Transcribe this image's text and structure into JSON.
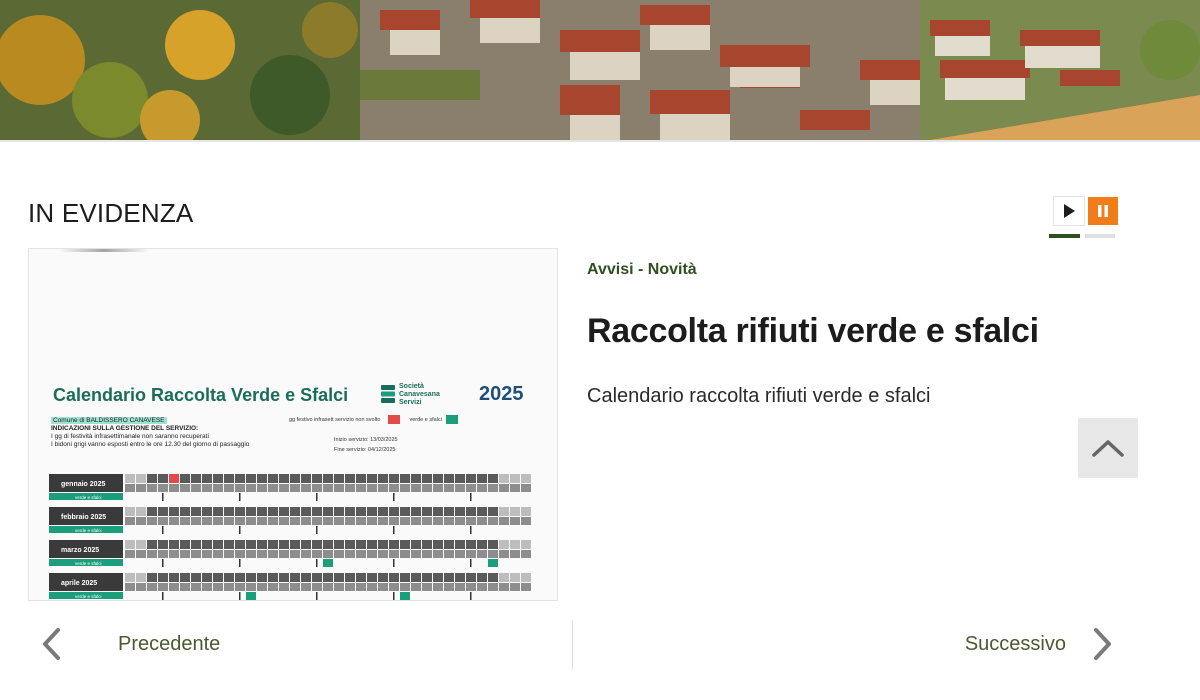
{
  "hero": {
    "colors": {
      "sky": "#5f7a3c",
      "roof": "#a7432d",
      "wall": "#d9d0c1",
      "foliage": "#c88f22",
      "grass": "#d9a45a"
    }
  },
  "section": {
    "title": "IN EVIDENZA"
  },
  "carousel": {
    "play_icon": "play-icon",
    "pause_icon": "pause-icon",
    "active_color": "#2f4f1f",
    "pause_color": "#f07d1a"
  },
  "feature_image": {
    "title": "Calendario Raccolta Verde e Sfalci",
    "year": "2025",
    "brand": [
      "Società",
      "Canavesana",
      "Servizi"
    ],
    "info": {
      "comune": "Comune di BALDISSERO CANAVESE",
      "heading": "INDICAZIONI SULLA GESTIONE DEL SERVIZIO:",
      "line1": "I gg di festività infrasettimanale non saranno recuperati",
      "line2": "I bidoni grigi vanno esposti entro le ore 12.30 del giorno di passaggio"
    },
    "legend": {
      "festivo": "gg festivo infrasett servizio non svolto",
      "verde": "verde e sfalci"
    },
    "dates": {
      "inizio": "Inizio servizio:  13/03/2025",
      "fine": "Fine servizio:  04/12/2025"
    },
    "months": [
      "gennaio 2025",
      "febbraio 2025",
      "marzo 2025",
      "aprile 2025"
    ],
    "row_tag": "verde e sfalci",
    "colors": {
      "green": "#1b9e7c",
      "red": "#e34b4b",
      "dark": "#5a5a5a",
      "light": "#bdbdbd"
    }
  },
  "article": {
    "category": "Avvisi - Novità",
    "title": "Raccolta rifiuti verde e sfalci",
    "description": "Calendario raccolta rifiuti verde e sfalci"
  },
  "back_to_top": {
    "icon": "chevron-up-icon"
  },
  "nav": {
    "prev_label": "Precedente",
    "next_label": "Successivo",
    "prev_icon": "chevron-left-icon",
    "next_icon": "chevron-right-icon"
  }
}
